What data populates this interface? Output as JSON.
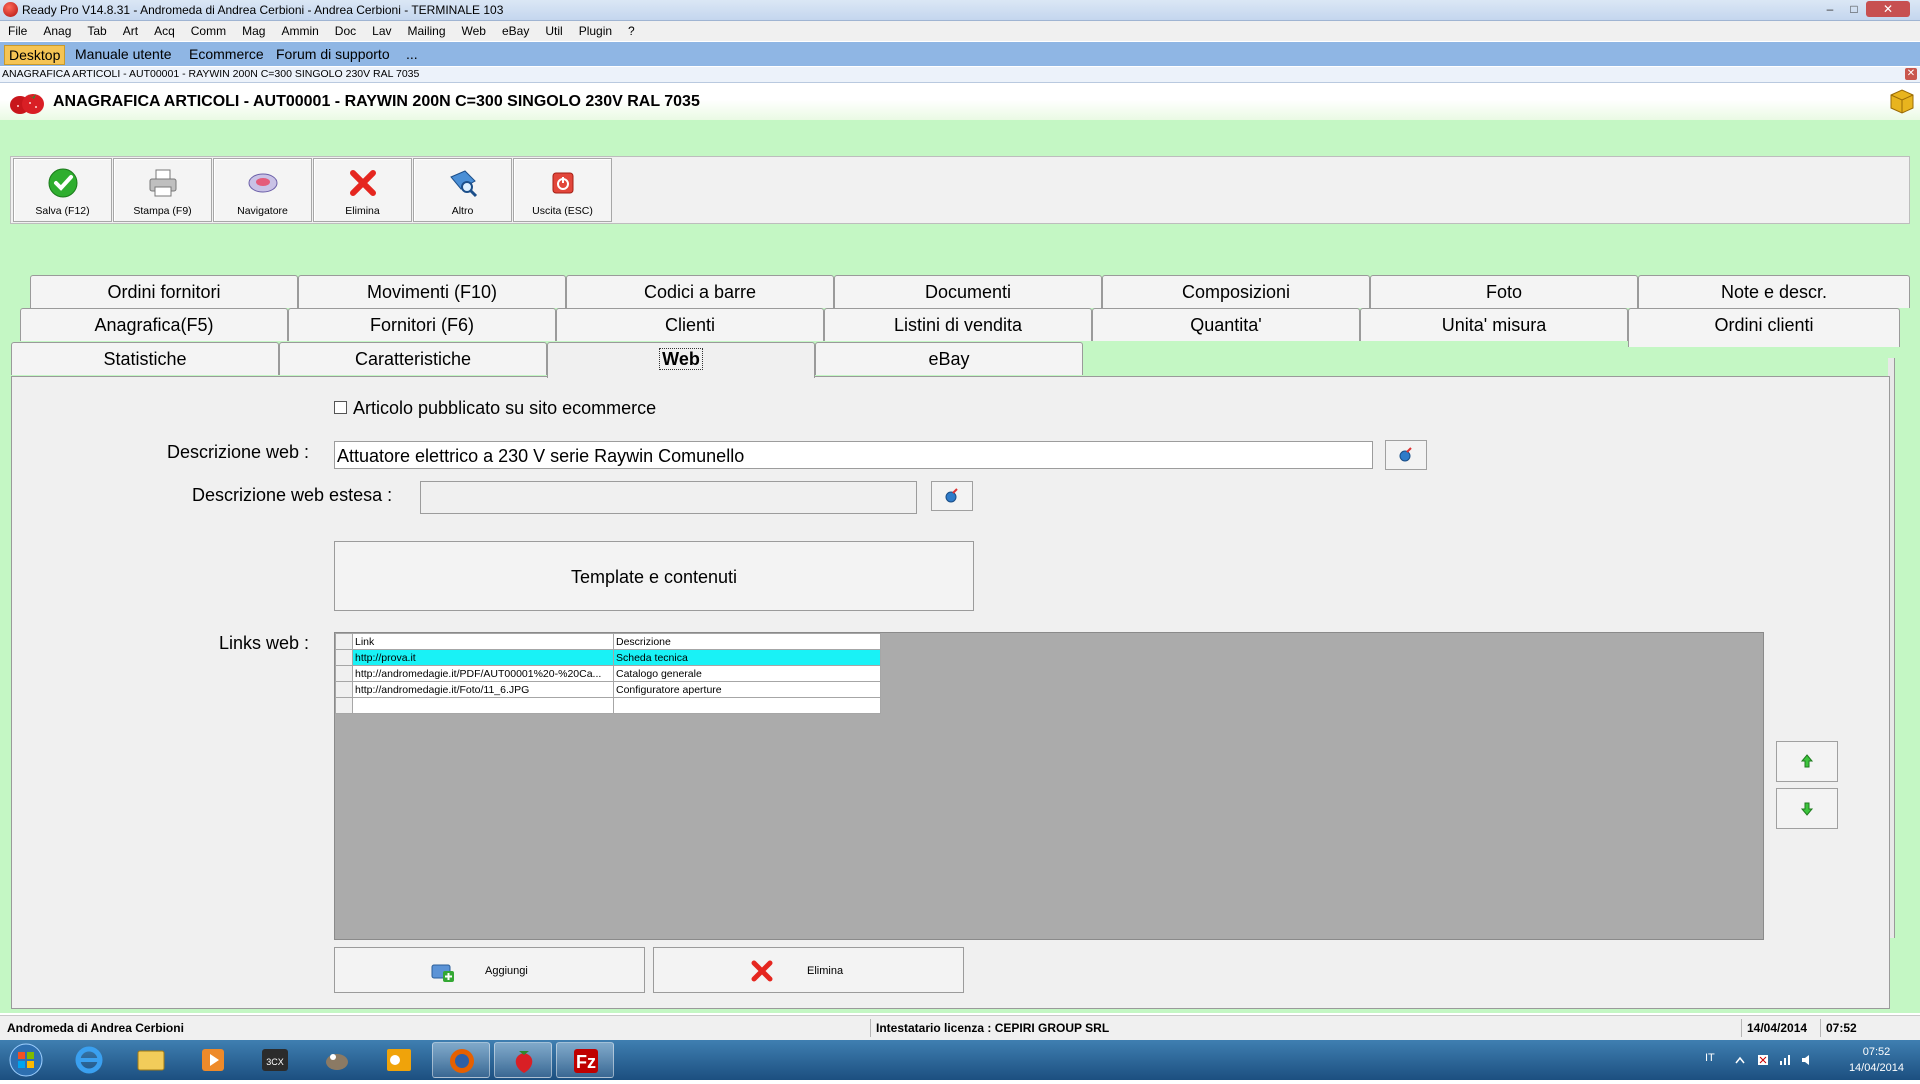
{
  "window": {
    "title": "Ready Pro V14.8.31 - Andromeda di Andrea Cerbioni - Andrea Cerbioni - TERMINALE 103"
  },
  "menu": [
    "File",
    "Anag",
    "Tab",
    "Art",
    "Acq",
    "Comm",
    "Mag",
    "Ammin",
    "Doc",
    "Lav",
    "Mailing",
    "Web",
    "eBay",
    "Util",
    "Plugin",
    "?"
  ],
  "quicklinks": [
    "Desktop",
    "Manuale utente",
    "Ecommerce",
    "Forum di supporto",
    "..."
  ],
  "subwindow": {
    "caption": "ANAGRAFICA ARTICOLI - AUT00001 - RAYWIN 200N C=300 SINGOLO 230V RAL 7035"
  },
  "header": {
    "title": "ANAGRAFICA ARTICOLI - AUT00001 - RAYWIN 200N C=300 SINGOLO 230V RAL 7035"
  },
  "toolbar": {
    "save": "Salva (F12)",
    "print": "Stampa (F9)",
    "navigator": "Navigatore",
    "delete": "Elimina",
    "other": "Altro",
    "exit": "Uscita (ESC)"
  },
  "tabs": {
    "row1": [
      "Ordini fornitori",
      "Movimenti (F10)",
      "Codici a barre",
      "Documenti",
      "Composizioni",
      "Foto",
      "Note e descr."
    ],
    "row2": [
      "Anagrafica(F5)",
      "Fornitori (F6)",
      "Clienti",
      "Listini di vendita",
      "Quantita'",
      "Unita' misura",
      "Ordini clienti"
    ],
    "row3": [
      "Statistiche",
      "Caratteristiche",
      "Web",
      "eBay"
    ]
  },
  "web": {
    "published_label": "Articolo pubblicato su sito ecommerce",
    "published": false,
    "desc_label": "Descrizione web :",
    "desc_value": "Attuatore elettrico a 230 V serie Raywin Comunello",
    "desc_ext_label": "Descrizione web estesa :",
    "desc_ext_value": "",
    "template_button": "Template e contenuti",
    "links_label": "Links web :",
    "grid_headers": [
      "Link",
      "Descrizione"
    ],
    "grid_rows": [
      {
        "link": "http://prova.it",
        "desc": "Scheda tecnica"
      },
      {
        "link": "http://andromedagie.it/PDF/AUT00001%20-%20Ca...",
        "desc": "Catalogo generale"
      },
      {
        "link": "http://andromedagie.it/Foto/11_6.JPG",
        "desc": "Configuratore aperture"
      },
      {
        "link": "",
        "desc": ""
      }
    ],
    "selected_row": 0,
    "add_button": "Aggiungi",
    "delete_button": "Elimina"
  },
  "statusbar": {
    "company": "Andromeda di Andrea Cerbioni",
    "license": "Intestatario licenza : CEPIRI GROUP SRL",
    "date": "14/04/2014",
    "time": "07:52"
  },
  "taskbar": {
    "lang": "IT",
    "clock_time": "07:52",
    "clock_date": "14/04/2014"
  },
  "colors": {
    "background_green": "#c4f7c4",
    "link_bar": "#8fb6e4",
    "active_link": "#f5c454",
    "grid_selection": "#19f2f6"
  }
}
